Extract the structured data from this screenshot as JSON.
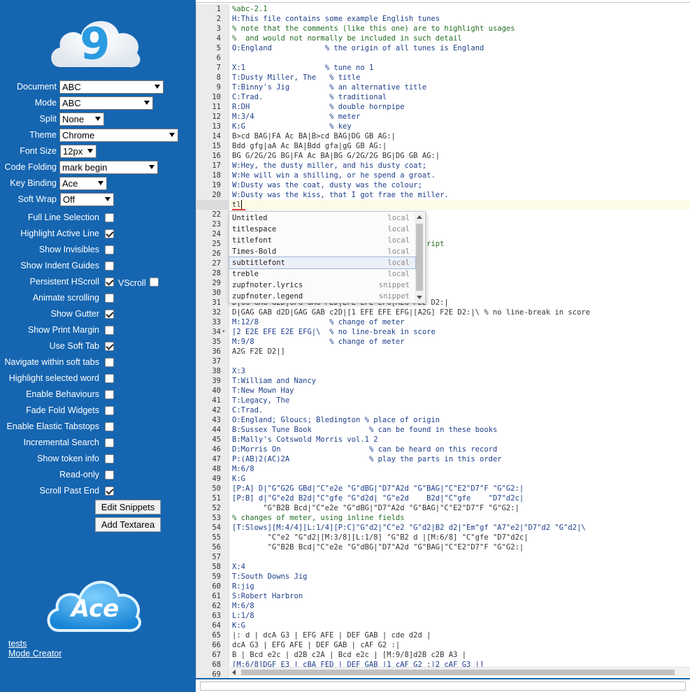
{
  "sidebar": {
    "logo_glyph": "9",
    "ace_logo_text": "Ace",
    "settings": {
      "document": {
        "label": "Document",
        "value": "ABC"
      },
      "mode": {
        "label": "Mode",
        "value": "ABC"
      },
      "split": {
        "label": "Split",
        "value": "None"
      },
      "theme": {
        "label": "Theme",
        "value": "Chrome"
      },
      "font_size": {
        "label": "Font Size",
        "value": "12px"
      },
      "code_folding": {
        "label": "Code Folding",
        "value": "mark begin"
      },
      "key_binding": {
        "label": "Key Binding",
        "value": "Ace"
      },
      "soft_wrap": {
        "label": "Soft Wrap",
        "value": "Off"
      }
    },
    "checkboxes": [
      {
        "label": "Full Line Selection",
        "checked": false
      },
      {
        "label": "Highlight Active Line",
        "checked": true
      },
      {
        "label": "Show Invisibles",
        "checked": false
      },
      {
        "label": "Show Indent Guides",
        "checked": false
      },
      {
        "label": "Persistent HScroll",
        "checked": true
      },
      {
        "label": "Animate scrolling",
        "checked": false
      },
      {
        "label": "Show Gutter",
        "checked": true
      },
      {
        "label": "Show Print Margin",
        "checked": false
      },
      {
        "label": "Use Soft Tab",
        "checked": true
      },
      {
        "label": "Navigate within soft tabs",
        "checked": false
      },
      {
        "label": "Highlight selected word",
        "checked": false
      },
      {
        "label": "Enable Behaviours",
        "checked": false
      },
      {
        "label": "Fade Fold Widgets",
        "checked": false
      },
      {
        "label": "Enable Elastic Tabstops",
        "checked": false
      },
      {
        "label": "Incremental Search",
        "checked": false
      },
      {
        "label": "Show token info",
        "checked": false
      },
      {
        "label": "Read-only",
        "checked": false
      },
      {
        "label": "Scroll Past End",
        "checked": true
      }
    ],
    "vscroll": {
      "label": "VScroll",
      "checked": false
    },
    "buttons": {
      "edit_snippets": "Edit Snippets",
      "add_textarea": "Add Textarea"
    },
    "links": {
      "tests": "tests",
      "mode_creator": "Mode Creator"
    }
  },
  "editor": {
    "lines": [
      {
        "n": 1,
        "text": "%abc-2.1"
      },
      {
        "n": 2,
        "text": "H:This file contains some example English tunes"
      },
      {
        "n": 3,
        "text": "% note that the comments (like this one) are to highlight usages"
      },
      {
        "n": 4,
        "text": "%  and would not normally be included in such detail"
      },
      {
        "n": 5,
        "text": "O:England            % the origin of all tunes is England"
      },
      {
        "n": 6,
        "text": ""
      },
      {
        "n": 7,
        "text": "X:1                  % tune no 1"
      },
      {
        "n": 8,
        "text": "T:Dusty Miller, The   % title"
      },
      {
        "n": 9,
        "text": "T:Binny's Jig         % an alternative title"
      },
      {
        "n": 10,
        "text": "C:Trad.               % traditional"
      },
      {
        "n": 11,
        "text": "R:DH                  % double hornpipe"
      },
      {
        "n": 12,
        "text": "M:3/4                 % meter"
      },
      {
        "n": 13,
        "text": "K:G                   % key"
      },
      {
        "n": 14,
        "text": "B>cd BAG|FA Ac BA|B>cd BAG|DG GB AG:|"
      },
      {
        "n": 15,
        "text": "Bdd gfg|aA Ac BA|Bdd gfa|gG GB AG:|"
      },
      {
        "n": 16,
        "text": "BG G/2G/2G BG|FA Ac BA|BG G/2G/2G BG|DG GB AG:|"
      },
      {
        "n": 17,
        "text": "W:Hey, the dusty miller, and his dusty coat;"
      },
      {
        "n": 18,
        "text": "W:He will win a shilling, or he spend a groat."
      },
      {
        "n": 19,
        "text": "W:Dusty was the coat, dusty was the colour;"
      },
      {
        "n": 20,
        "text": "W:Dusty was the kiss, that I got frae the miller."
      },
      {
        "n": 21,
        "text": "tl"
      },
      {
        "n": 22,
        "text": ""
      },
      {
        "n": 23,
        "text": ""
      },
      {
        "n": 24,
        "text": ""
      },
      {
        "n": 25,
        "text": "                                            ript"
      },
      {
        "n": 26,
        "text": ""
      },
      {
        "n": 27,
        "text": ""
      },
      {
        "n": 28,
        "text": ""
      },
      {
        "n": 29,
        "text": ""
      },
      {
        "n": 30,
        "text": ""
      },
      {
        "n": 31,
        "text": "D|GG GAG G2D|GFG GAG F2D|EFE EFE EFG|A2G F2E D2:|"
      },
      {
        "n": 32,
        "text": "D|GAG GAB d2D|GAG GAB c2D|[1 EFE EFE EFG|[A2G] F2E D2:|\\ % no line-break in score"
      },
      {
        "n": 33,
        "text": "M:12/8                % change of meter"
      },
      {
        "n": 34,
        "text": "[2 E2E EFE E2E EFG|\\  % no line-break in score"
      },
      {
        "n": 35,
        "text": "M:9/8                 % change of meter"
      },
      {
        "n": 36,
        "text": "A2G F2E D2|]"
      },
      {
        "n": 37,
        "text": ""
      },
      {
        "n": 38,
        "text": "X:3"
      },
      {
        "n": 39,
        "text": "T:William and Nancy"
      },
      {
        "n": 40,
        "text": "T:New Mown Hay"
      },
      {
        "n": 41,
        "text": "T:Legacy, The"
      },
      {
        "n": 42,
        "text": "C:Trad."
      },
      {
        "n": 43,
        "text": "O:England; Gloucs; Bledington % place of origin"
      },
      {
        "n": 44,
        "text": "B:Sussex Tune Book             % can be found in these books"
      },
      {
        "n": 45,
        "text": "B:Mally's Cotswold Morris vol.1 2"
      },
      {
        "n": 46,
        "text": "D:Morris On                    % can be heard on this record"
      },
      {
        "n": 47,
        "text": "P:(AB)2(AC)2A                  % play the parts in this order"
      },
      {
        "n": 48,
        "text": "M:6/8"
      },
      {
        "n": 49,
        "text": "K:G"
      },
      {
        "n": 50,
        "text": "[P:A] D|\"G\"G2G GBd|\"C\"e2e \"G\"dBG|\"D7\"A2d \"G\"BAG|\"C\"E2\"D7\"F \"G\"G2:|"
      },
      {
        "n": 51,
        "text": "[P:B] d|\"G\"e2d B2d|\"C\"gfe \"G\"d2d| \"G\"e2d    B2d|\"C\"gfe    \"D7\"d2c|"
      },
      {
        "n": 52,
        "text": "       \"G\"B2B Bcd|\"C\"e2e \"G\"dBG|\"D7\"A2d \"G\"BAG|\"C\"E2\"D7\"F \"G\"G2:|"
      },
      {
        "n": 53,
        "text": "% changes of meter, using inline fields"
      },
      {
        "n": 54,
        "text": "[T:Slows][M:4/4][L:1/4][P:C]\"G\"d2|\"C\"e2 \"G\"d2|B2 d2|\"Em\"gf \"A7\"e2|\"D7\"d2 \"G\"d2|\\"
      },
      {
        "n": 55,
        "text": "        \"C\"e2 \"G\"d2|[M:3/8][L:1/8] \"G\"B2 d |[M:6/8] \"C\"gfe \"D7\"d2c|"
      },
      {
        "n": 56,
        "text": "        \"G\"B2B Bcd|\"C\"e2e \"G\"dBG|\"D7\"A2d \"G\"BAG|\"C\"E2\"D7\"F \"G\"G2:|"
      },
      {
        "n": 57,
        "text": ""
      },
      {
        "n": 58,
        "text": "X:4"
      },
      {
        "n": 59,
        "text": "T:South Downs Jig"
      },
      {
        "n": 60,
        "text": "R:jig"
      },
      {
        "n": 61,
        "text": "S:Robert Harbron"
      },
      {
        "n": 62,
        "text": "M:6/8"
      },
      {
        "n": 63,
        "text": "L:1/8"
      },
      {
        "n": 64,
        "text": "K:G"
      },
      {
        "n": 65,
        "text": "|: d | dcA G3 | EFG AFE | DEF GAB | cde d2d |"
      },
      {
        "n": 66,
        "text": "dcA G3 | EFG AFE | DEF GAB | cAF G2 :|"
      },
      {
        "n": 67,
        "text": "B | Bcd e2c | d2B c2A | Bcd e2c | [M:9/8]d2B c2B A3 |"
      },
      {
        "n": 68,
        "text": "[M:6/8]DGF E3 | cBA FED | DEF GAB |1 cAF G2 :|2 cAF G3 |]"
      },
      {
        "n": 69,
        "text": ""
      }
    ],
    "autocomplete": [
      {
        "caption": "Untitled",
        "meta": "local"
      },
      {
        "caption": "titlespace",
        "meta": "local"
      },
      {
        "caption": "titlefont",
        "meta": "local"
      },
      {
        "caption": "Times-Bold",
        "meta": "local"
      },
      {
        "caption": "subtitlefont",
        "meta": "local"
      },
      {
        "caption": "treble",
        "meta": "local"
      },
      {
        "caption": "zupfnoter.lyrics",
        "meta": "snippet"
      },
      {
        "caption": "zupfnoter.legend",
        "meta": "snippet"
      }
    ]
  },
  "colors": {
    "sidebar_bg": "#1565b0",
    "code_text": "#1e3f8a",
    "comment": "#236e24",
    "active_line": "#fcfce6",
    "gutter_bg": "#ebebeb"
  }
}
